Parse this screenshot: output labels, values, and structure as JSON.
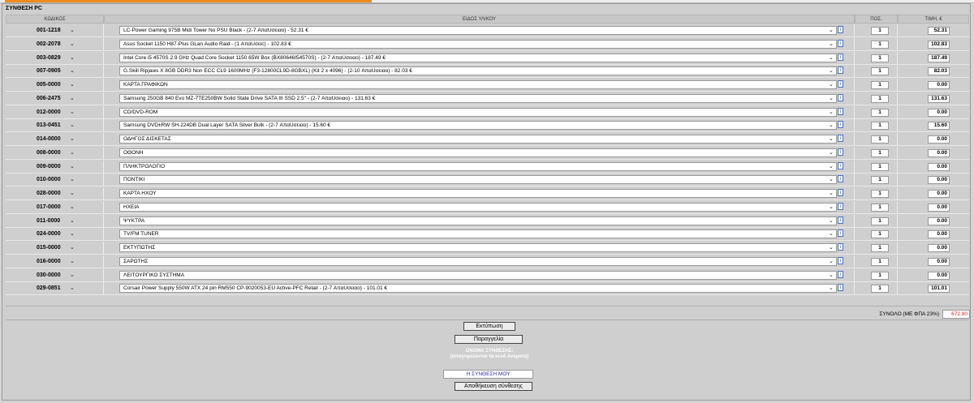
{
  "panel": {
    "title": "ΣΥΝΘΕΣΗ PC"
  },
  "table": {
    "headers": {
      "code": "ΚΩΔΙΚΟΣ",
      "item": "ΕΙΔΟΣ ΥΛΙΚΟΥ",
      "qty": "ΠΟΣ.",
      "price": "ΤΙΜΗ, €"
    },
    "rows": [
      {
        "code": "001-1218",
        "desc": "LC-Power Gaming 975B Midi Tower No PSU Black - (2-7 ΑπαUσειαο) - 52.31 €",
        "qty": "1",
        "price": "52.31"
      },
      {
        "code": "002-2078",
        "desc": "Asus Socket 1150 H87-Plus GLan Audio Raid - (1 ΑπαUσειc) - 102.83 €",
        "qty": "1",
        "price": "102.83"
      },
      {
        "code": "003-0829",
        "desc": "Intel Core i5 4570S 2.9 GHz Quad Core Socket 1150 65W Box (BX80646I54570S) - (2-7 ΑπαUσειαο) - 187.49 €",
        "qty": "1",
        "price": "187.49"
      },
      {
        "code": "007-0905",
        "desc": "G.Skill Ripjaws X 8GB DDR3 Non ECC CL9 1600MHz (F3-12800CL9D-8GBXL) (Kit 2 x 4096) - (2-10 ΑπαUσειαο) - 82.03 €",
        "qty": "1",
        "price": "82.03"
      },
      {
        "code": "005-0000",
        "desc": "ΚΑΡΤΑ ΓΡΑΦΙΚΩΝ",
        "qty": "1",
        "price": "0.00"
      },
      {
        "code": "006-2475",
        "desc": "Samsung 250GB 840 Evo MZ-7TE250BW Solid State Drive SATA III SSD 2.5\" - (2-7 ΑπαUσειαο) - 131.63 €",
        "qty": "1",
        "price": "131.63"
      },
      {
        "code": "012-0000",
        "desc": "CD/DVD-ROM",
        "qty": "1",
        "price": "0.00"
      },
      {
        "code": "013-0451",
        "desc": "Samsung DVD±RW SH-224DB Dual Layer SATA Silver Bulk - (2-7 ΑπαUσειαο) - 15.60 €",
        "qty": "1",
        "price": "15.60"
      },
      {
        "code": "014-0000",
        "desc": "ΟΔΗΓΟΣ ΔΙΣΚΕΤΑΣ",
        "qty": "1",
        "price": "0.00"
      },
      {
        "code": "008-0000",
        "desc": "ΟΘΟΝΗ",
        "qty": "1",
        "price": "0.00"
      },
      {
        "code": "009-0000",
        "desc": "ΠΛΗΚΤΡΟΛΟΓΙΟ",
        "qty": "1",
        "price": "0.00"
      },
      {
        "code": "010-0000",
        "desc": "ΠΟΝΤΙΚΙ",
        "qty": "1",
        "price": "0.00"
      },
      {
        "code": "028-0000",
        "desc": "ΚΑΡΤΑ ΗΧΟΥ",
        "qty": "1",
        "price": "0.00"
      },
      {
        "code": "017-0000",
        "desc": "ΗΧΕΙΑ",
        "qty": "1",
        "price": "0.00"
      },
      {
        "code": "011-0000",
        "desc": "ΨΥΚΤΡΑ",
        "qty": "1",
        "price": "0.00"
      },
      {
        "code": "024-0000",
        "desc": "TV/FM TUNER",
        "qty": "1",
        "price": "0.00"
      },
      {
        "code": "015-0000",
        "desc": "ΕΚΤΥΠΩΤΗΣ",
        "qty": "1",
        "price": "0.00"
      },
      {
        "code": "016-0000",
        "desc": "ΣΑΡΩΤΗΣ",
        "qty": "1",
        "price": "0.00"
      },
      {
        "code": "030-0000",
        "desc": "ΛΕΙΤΟΥΡΓΙΚΟ ΣΥΣΤΗΜΑ",
        "qty": "1",
        "price": "0.00"
      },
      {
        "code": "029-0851",
        "desc": "Corsair Power Supply 550W ATX 24 pin RM550 CP-9020053-EU Active-PFC Retail - (2-7 ΑπαUσειαο) - 101.01 €",
        "qty": "1",
        "price": "101.01"
      }
    ]
  },
  "totals": {
    "label": "ΣΥΝΟΛΟ (ΜΕ ΦΠΑ 23%)",
    "value": "672.90"
  },
  "actions": {
    "print_label": "Εκτύπωση",
    "order_label": "Παραγγελία",
    "name_caption": "ΟΝΟΜΑ ΣΥΝΘΕΣΗΣ:",
    "name_hint": "(απαγορεύονται τα κενά όνοματα)",
    "name_value": "Η ΣΥΝΘΕΣΗ ΜΟΥ",
    "save_label": "Αποθήκευση σύνθεσης"
  },
  "icons": {
    "dropdown": "chevron-down-icon",
    "info": "info-icon"
  },
  "colors": {
    "accent": "#f08a1c",
    "total": "#d81818",
    "name_text": "#2c2cb0"
  }
}
